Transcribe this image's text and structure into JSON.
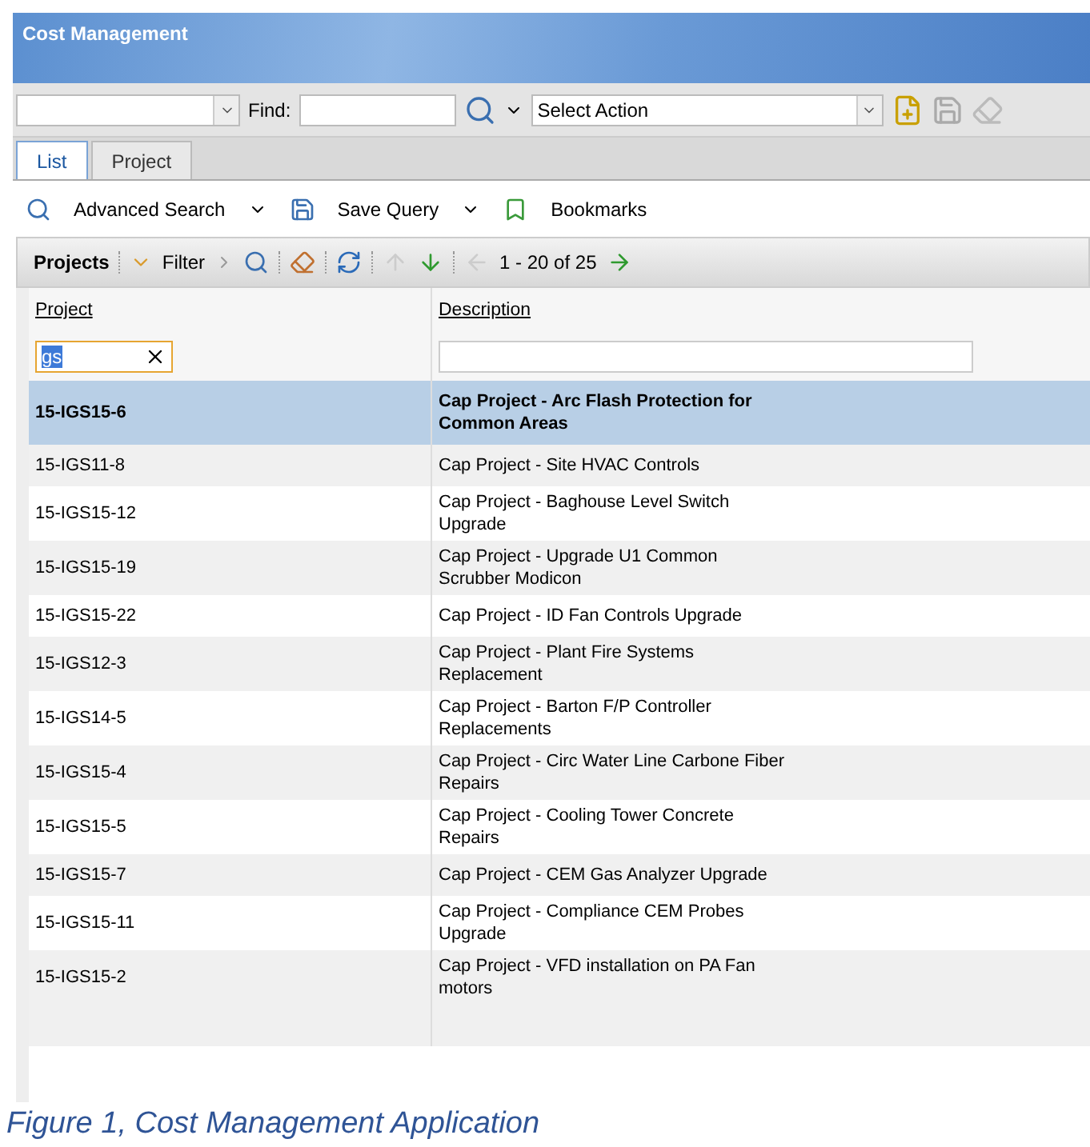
{
  "window": {
    "title": "Cost Management"
  },
  "toolbar": {
    "find_label": "Find:",
    "action_select": "Select Action"
  },
  "tabs": [
    {
      "label": "List",
      "selected": true
    },
    {
      "label": "Project",
      "selected": false
    }
  ],
  "actions": [
    "Advanced Search",
    "Save Query",
    "Bookmarks"
  ],
  "grid_toolbar": {
    "title": "Projects",
    "filter": "Filter",
    "range": "1 - 20 of 25"
  },
  "table": {
    "columns": [
      "Project",
      "Description"
    ],
    "filter": {
      "value": "gs"
    },
    "rows": [
      {
        "project": "15-IGS15-6",
        "description": "Cap Project - Arc Flash Protection for Common Areas",
        "selected": true
      },
      {
        "project": "15-IGS11-8",
        "description": "Cap Project - Site HVAC Controls",
        "selected": false
      },
      {
        "project": "15-IGS15-12",
        "description": "Cap Project - Baghouse Level Switch Upgrade",
        "selected": false
      },
      {
        "project": "15-IGS15-19",
        "description": "Cap Project - Upgrade U1 Common Scrubber Modicon",
        "selected": false
      },
      {
        "project": "15-IGS15-22",
        "description": "Cap Project - ID Fan Controls Upgrade",
        "selected": false
      },
      {
        "project": "15-IGS12-3",
        "description": "Cap Project - Plant Fire Systems Replacement",
        "selected": false
      },
      {
        "project": "15-IGS14-5",
        "description": "Cap Project - Barton F/P Controller Replacements",
        "selected": false
      },
      {
        "project": "15-IGS15-4",
        "description": "Cap Project - Circ Water Line Carbone Fiber Repairs",
        "selected": false
      },
      {
        "project": "15-IGS15-5",
        "description": "Cap Project - Cooling Tower Concrete Repairs",
        "selected": false
      },
      {
        "project": "15-IGS15-7",
        "description": "Cap Project - CEM Gas Analyzer Upgrade",
        "selected": false
      },
      {
        "project": "15-IGS15-11",
        "description": "Cap Project - Compliance CEM Probes Upgrade",
        "selected": false
      },
      {
        "project": "15-IGS15-2",
        "description": "Cap Project - VFD installation on PA Fan motors",
        "selected": false
      }
    ]
  },
  "caption": "Figure 1, Cost Management Application"
}
